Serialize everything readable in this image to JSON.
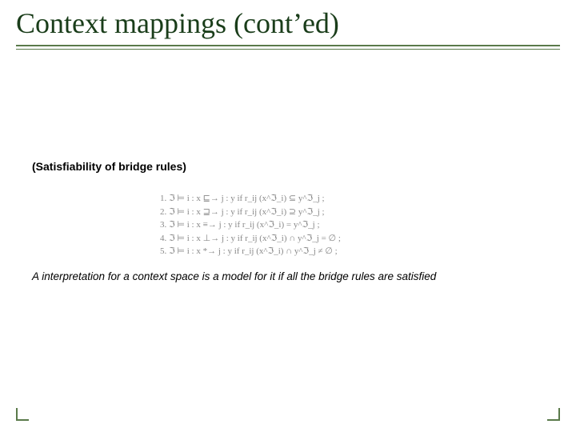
{
  "title": "Context mappings (cont’ed)",
  "subhead": "(Satisfiability of bridge rules)",
  "rules": {
    "r1": "1.  ℑ ⊨ i : x  ⊑→  j : y  if  r_ij (x^ℑ_i) ⊆ y^ℑ_j ;",
    "r2": "2.  ℑ ⊨ i : x  ⊒→  j : y  if  r_ij (x^ℑ_i) ⊇ y^ℑ_j ;",
    "r3": "3.  ℑ ⊨ i : x  ≡→  j : y  if  r_ij (x^ℑ_i) = y^ℑ_j ;",
    "r4": "4.  ℑ ⊨ i : x  ⊥→  j : y  if  r_ij (x^ℑ_i) ∩ y^ℑ_j = ∅ ;",
    "r5": "5.  ℑ ⊨ i : x  *→  j : y  if  r_ij (x^ℑ_i) ∩ y^ℑ_j ≠ ∅ ;"
  },
  "footnote": "A interpretation for a context space is a model for it if all the bridge rules are satisfied"
}
